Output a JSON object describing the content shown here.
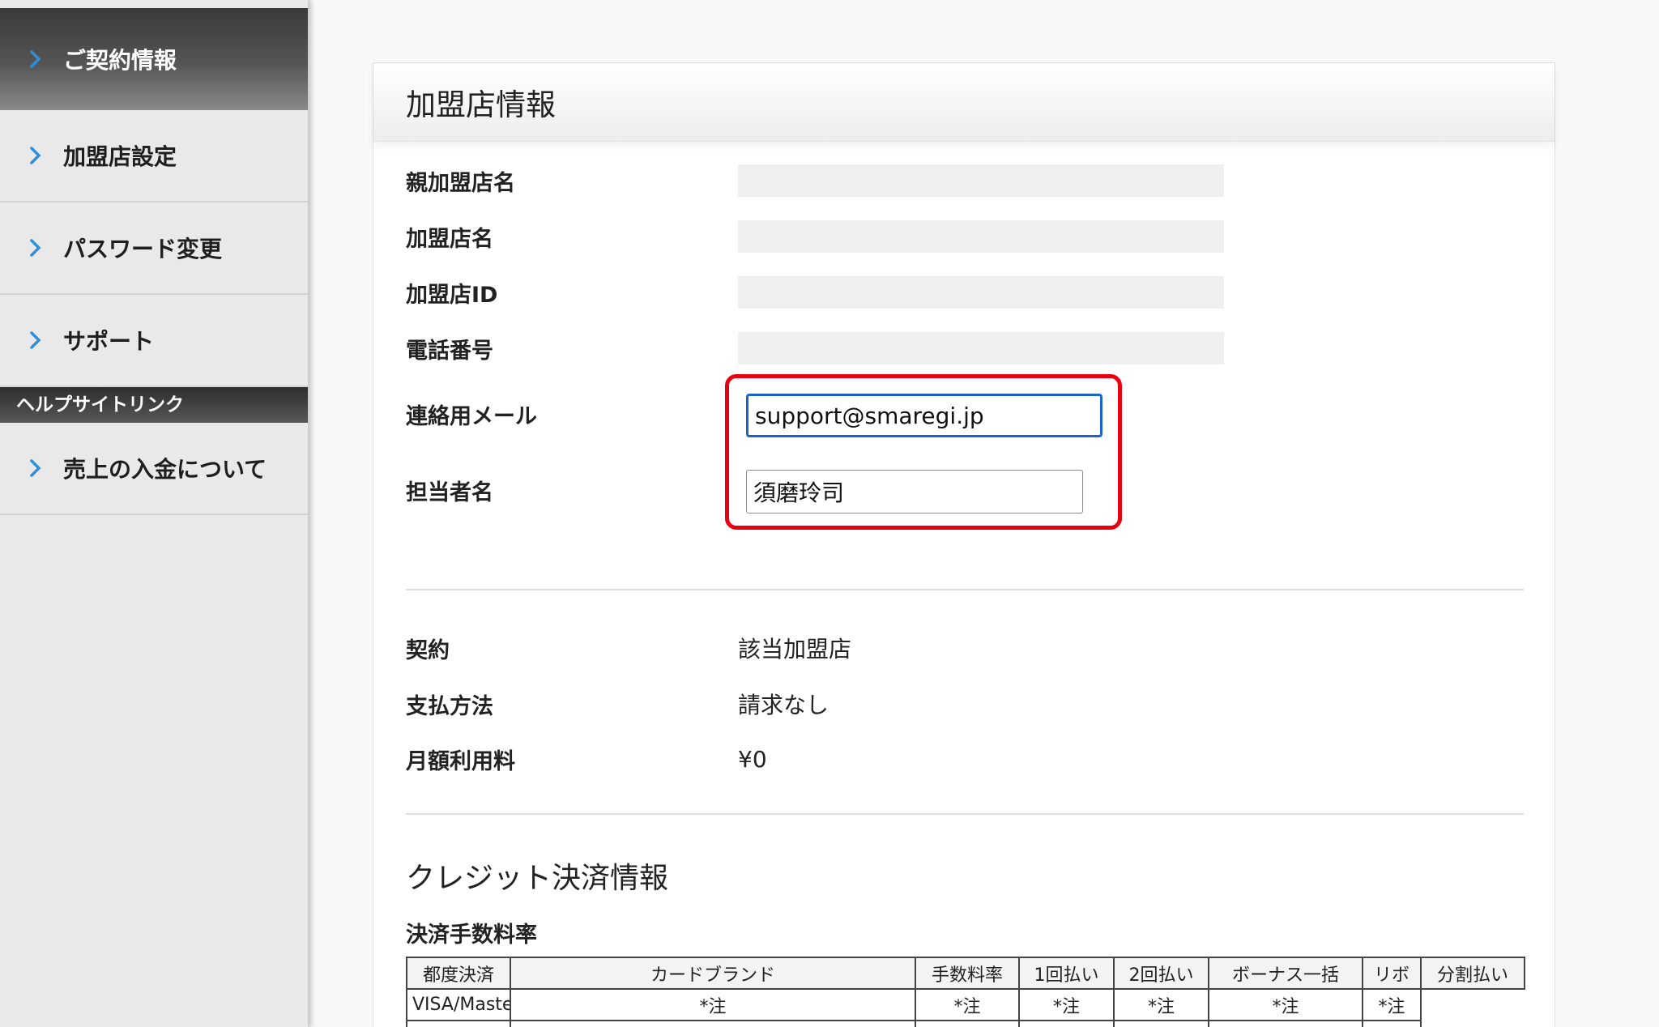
{
  "sidebar": {
    "items": [
      {
        "label": "ご契約情報"
      },
      {
        "label": "加盟店設定"
      },
      {
        "label": "パスワード変更"
      },
      {
        "label": "サポート"
      }
    ],
    "help_section": {
      "heading": "ヘルプサイトリンク",
      "items": [
        {
          "label": "売上の入金について"
        }
      ]
    }
  },
  "card": {
    "title": "加盟店情報",
    "fields": {
      "parent_store_name": {
        "label": "親加盟店名"
      },
      "store_name": {
        "label": "加盟店名"
      },
      "store_id": {
        "label": "加盟店ID"
      },
      "phone": {
        "label": "電話番号"
      },
      "contact_email": {
        "label": "連絡用メール",
        "value": "support@smaregi.jp"
      },
      "person_in_charge": {
        "label": "担当者名",
        "value": "須磨玲司"
      }
    },
    "contract": {
      "contract": {
        "label": "契約",
        "value": "該当加盟店"
      },
      "payment_method": {
        "label": "支払方法",
        "value": "請求なし"
      },
      "monthly_fee": {
        "label": "月額利用料",
        "value": "¥0"
      }
    },
    "credit": {
      "title": "クレジット決済情報",
      "fee_rate_heading": "決済手数料率",
      "table": {
        "headers": [
          "カードブランド",
          "手数料率",
          "1回払い",
          "2回払い",
          "ボーナス一括",
          "リボ",
          "分割払い"
        ],
        "row_kind": "都度決済",
        "rows": [
          {
            "brand": "VISA/MasterCard",
            "cells": [
              "*注",
              "*注",
              "*注",
              "*注",
              "*注",
              "*注"
            ]
          }
        ]
      }
    }
  },
  "colors": {
    "highlight_border": "#e60012",
    "focus_border": "#1a63d0",
    "chevron": "#2e8fd6"
  },
  "icons": {
    "nav_item": "chevron-right-icon"
  }
}
